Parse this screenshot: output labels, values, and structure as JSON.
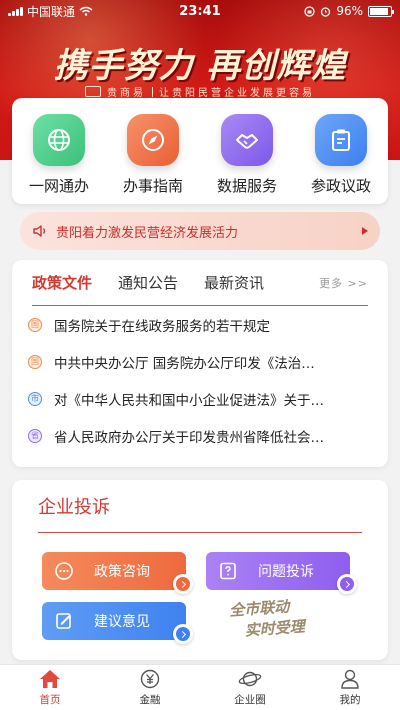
{
  "status_bar": {
    "carrier": "中国联通",
    "time": "23:41",
    "battery": "96%"
  },
  "banner": {
    "slogan": "携手努力 再创辉煌",
    "subtitle_brand": "贵商易",
    "subtitle": "让贵阳民营企业发展更容易"
  },
  "services": [
    {
      "label": "一网通办",
      "icon": "globe-icon",
      "color": "#4ccf8a"
    },
    {
      "label": "办事指南",
      "icon": "compass-icon",
      "color": "#f2744a"
    },
    {
      "label": "数据服务",
      "icon": "handshake-icon",
      "color": "#8f6cf0"
    },
    {
      "label": "参政议政",
      "icon": "clipboard-icon",
      "color": "#4b8ff2"
    }
  ],
  "notice": {
    "text": "贵阳着力激发民营经济发展活力"
  },
  "news": {
    "tabs": [
      "政策文件",
      "通知公告",
      "最新资讯"
    ],
    "more": "更多 >>",
    "items": [
      {
        "tag": "国",
        "tag_color": "#f08a4b",
        "title": "国务院关于在线政务服务的若干规定"
      },
      {
        "tag": "国",
        "tag_color": "#f08a4b",
        "title": "中共中央办公厅 国务院办公厅印发《法治…"
      },
      {
        "tag": "市",
        "tag_color": "#4b8ff2",
        "title": "对《中华人民共和国中小企业促进法》关于…"
      },
      {
        "tag": "省",
        "tag_color": "#8f6cf0",
        "title": "省人民政府办公厅关于印发贵州省降低社会…"
      }
    ]
  },
  "complaint": {
    "title": "企业投诉",
    "buttons": [
      {
        "label": "政策咨询",
        "color": "#f2744a"
      },
      {
        "label": "问题投诉",
        "color": "#9b6cf0"
      },
      {
        "label": "建议意见",
        "color": "#4b8ff2"
      }
    ],
    "stamp_line1": "全市联动",
    "stamp_line2": "实时受理"
  },
  "bottom_nav": [
    {
      "label": "首页",
      "icon": "home-icon"
    },
    {
      "label": "金融",
      "icon": "yuan-icon"
    },
    {
      "label": "企业圈",
      "icon": "planet-icon"
    },
    {
      "label": "我的",
      "icon": "person-icon"
    }
  ],
  "colors": {
    "brand_red": "#d23a30",
    "active_nav": "#d23a30"
  }
}
